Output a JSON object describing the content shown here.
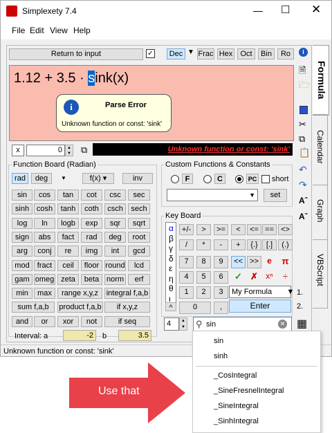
{
  "app": {
    "title": "Simplexety 7.4"
  },
  "menu": [
    "File",
    "Edit",
    "View",
    "Help"
  ],
  "toolbar": {
    "return": "Return to input",
    "bases": [
      "Dec",
      "Frac",
      "Hex",
      "Oct",
      "Bin",
      "Ro"
    ]
  },
  "expr": {
    "pre": "1.12 + 3.5 · ",
    "sel": "s",
    "post": "ink(x)"
  },
  "tip": {
    "title": "Parse Error",
    "msg": "Unknown function or const: 'sink'"
  },
  "varbar": {
    "name": "x",
    "value": "0",
    "error": "Unknown function or const: 'sink'"
  },
  "fb": {
    "title": "Function Board (Radian)",
    "top": [
      "rad",
      "deg",
      "f(x)",
      "inv"
    ],
    "rows": [
      [
        "sin",
        "cos",
        "tan",
        "cot",
        "csc",
        "sec"
      ],
      [
        "sinh",
        "cosh",
        "tanh",
        "coth",
        "csch",
        "sech"
      ],
      [
        "log",
        "ln",
        "logb",
        "exp",
        "sqr",
        "sqrt"
      ],
      [
        "sign",
        "abs",
        "fact",
        "rad",
        "deg",
        "root"
      ],
      [
        "arg",
        "conj",
        "re",
        "img",
        "int",
        "gcd"
      ],
      [
        "mod",
        "fract",
        "ceil",
        "floor",
        "round",
        "lcd"
      ],
      [
        "gam",
        "omeg",
        "zeta",
        "beta",
        "norm",
        "erf"
      ],
      [
        "min",
        "max"
      ]
    ],
    "r7b": [
      "range x,y,z",
      "integral f,a,b"
    ],
    "r8": [
      "sum f,a,b",
      "product f,a,b",
      "if x,y,z"
    ],
    "r9": [
      "and",
      "or",
      "xor",
      "not",
      "if seq"
    ],
    "interval_label": "Interval: a",
    "a": "-2",
    "b_label": "b",
    "b": "3.5"
  },
  "cf": {
    "title": "Custom Functions & Constants",
    "r": [
      "F",
      "C",
      "PC"
    ],
    "short": "short",
    "set": "set"
  },
  "kb": {
    "title": "Key Board",
    "greek": [
      "α",
      "β",
      "γ",
      "δ",
      "ε",
      "η",
      "θ",
      "ι"
    ],
    "r1": [
      "+/-",
      ">",
      ">=",
      "<",
      "<=",
      "==",
      "<>"
    ],
    "r2": [
      "/",
      "*",
      "-",
      "+",
      "{.}",
      "[.]",
      "(.)"
    ],
    "d1": [
      "7",
      "8",
      "9"
    ],
    "d2": [
      "4",
      "5",
      "6"
    ],
    "d3": [
      "1",
      "2",
      "3"
    ],
    "zero": "0",
    "dot": ",",
    "hat": "^",
    "sp": [
      "<<",
      ">>",
      "e",
      "π"
    ],
    "formula": "My Formula",
    "enter": "Enter",
    "n1": "1.",
    "n2": "2."
  },
  "search": {
    "num": "4",
    "value": "sin"
  },
  "tabs": [
    "Formula",
    "Calendar",
    "Graph",
    "VBScript"
  ],
  "status": "Unknown function or const: 'sink'",
  "popup": [
    "sin",
    "sinh",
    "_CosIntegral",
    "_SineFresnelIntegral",
    "_SineIntegral",
    "_SinhIntegral"
  ],
  "annot": "Use that"
}
